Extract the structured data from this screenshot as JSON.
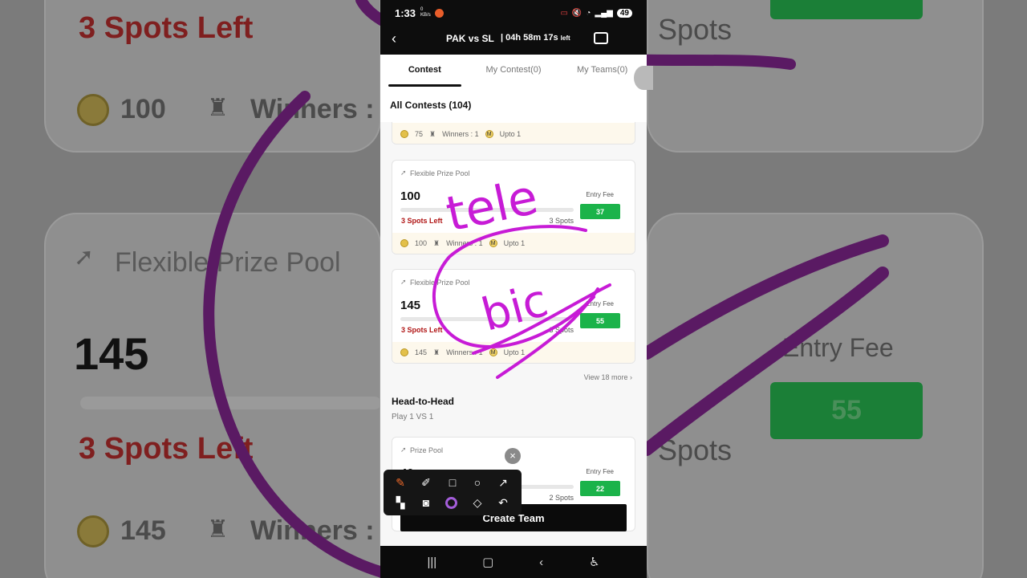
{
  "status_bar": {
    "time": "1:33",
    "net_speed": "0 KB/s",
    "battery": "49"
  },
  "header": {
    "match": "PAK vs SL",
    "timer": "04h 58m 17s",
    "timer_suffix": "left"
  },
  "tabs": [
    {
      "label": "Contest",
      "active": true
    },
    {
      "label": "My Contest(0)",
      "active": false
    },
    {
      "label": "My Teams(0)",
      "active": false
    }
  ],
  "section_title": "All Contests (104)",
  "partial_card_footer": {
    "prize": "75",
    "winners": "Winners : 1",
    "upto": "Upto 1"
  },
  "contests": [
    {
      "pool_label": "Flexible Prize Pool",
      "prize": "100",
      "entry_label": "Entry Fee",
      "entry_fee": "37",
      "spots_left": "3 Spots Left",
      "spots_total": "3 Spots",
      "footer": {
        "prize": "100",
        "winners": "Winners : 1",
        "upto": "Upto 1"
      }
    },
    {
      "pool_label": "Flexible Prize Pool",
      "prize": "145",
      "entry_label": "Entry Fee",
      "entry_fee": "55",
      "spots_left": "3 Spots Left",
      "spots_total": "3 Spots",
      "footer": {
        "prize": "145",
        "winners": "Winners : 1",
        "upto": "Upto 1"
      }
    }
  ],
  "view_more": "View 18 more",
  "head_to_head": {
    "title": "Head-to-Head",
    "subtitle": "Play 1 VS 1",
    "card": {
      "pool_label": "Prize Pool",
      "prize": "40",
      "entry_label": "Entry Fee",
      "entry_fee": "22",
      "spots_total": "2 Spots"
    }
  },
  "create_team_label": "Create Team",
  "annotations": {
    "scribble_1": "tele",
    "scribble_2": "bic"
  },
  "background": {
    "top_spots": "3 Spots Left",
    "top_prize": "100",
    "top_winners": "Winners :",
    "pool_label": "Flexible Prize Pool",
    "prize": "145",
    "spots_left": "3 Spots Left",
    "entry_label": "Entry Fee",
    "entry_fee": "55",
    "bottom_prize": "145",
    "bottom_winners": "Winners :",
    "right_spots_top": "Spots",
    "right_spots_bottom": "Spots"
  },
  "colors": {
    "accent_green": "#1bb34a",
    "spots_red": "#b01515",
    "annotation_purple": "#c71bd6",
    "dark": "#0d0d0d"
  }
}
